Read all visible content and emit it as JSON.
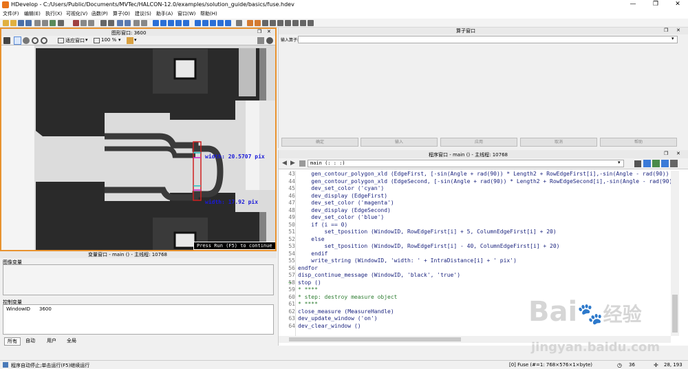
{
  "app": {
    "title": "HDevelop - C:/Users/Public/Documents/MVTec/HALCON-12.0/examples/solution_guide/basics/fuse.hdev",
    "logo": "HD",
    "minimize": "—",
    "maximize": "❐",
    "close": "✕"
  },
  "menu": [
    "文件(F)",
    "编辑(E)",
    "执行(X)",
    "可视化(V)",
    "函数(P)",
    "算子(O)",
    "建议(S)",
    "助手(A)",
    "窗口(W)",
    "帮助(H)"
  ],
  "graphics": {
    "title": "图形窗口: 3600",
    "zoom_fit": "适应窗口",
    "zoom_pct": "100 %",
    "label_top": "width: 20.5707 pix",
    "label_bottom": "width: 17.92 pix",
    "continue_msg": "Press Run (F5) to continue"
  },
  "variables": {
    "title": "变量窗口 - main () - 主线程: 10768",
    "image_vars_label": "图像变量",
    "control_vars_label": "控制变量",
    "control_vars": [
      {
        "name": "WindowID",
        "value": "3600"
      }
    ],
    "tabs": [
      "所有",
      "自动",
      "用户",
      "全局"
    ]
  },
  "operator": {
    "title": "算子窗口",
    "input_label": "输入算子或函数",
    "buttons": [
      "确定",
      "输入",
      "应用",
      "取消",
      "帮助"
    ]
  },
  "program": {
    "title": "程序窗口 - main () - 主线程: 10768",
    "proc_select": "main (: : :)",
    "pc_line": 58,
    "lines": [
      {
        "n": "43",
        "t": "    gen_contour_polygon_xld (EdgeFirst, [-sin(Angle + rad(90)) * Length2 + RowEdgeFirst[i],-sin(Angle - rad(90)) * L",
        "c": "#1a237e"
      },
      {
        "n": "44",
        "t": "    gen_contour_polygon_xld (EdgeSecond, [-sin(Angle + rad(90)) * Length2 + RowEdgeSecond[i],-sin(Angle - rad(90)) *",
        "c": "#1a237e"
      },
      {
        "n": "45",
        "t": "    dev_set_color ('cyan')",
        "c": "#1a237e"
      },
      {
        "n": "46",
        "t": "    dev_display (EdgeFirst)",
        "c": "#1a237e"
      },
      {
        "n": "47",
        "t": "    dev_set_color ('magenta')",
        "c": "#1a237e"
      },
      {
        "n": "48",
        "t": "    dev_display (EdgeSecond)",
        "c": "#1a237e"
      },
      {
        "n": "49",
        "t": "    dev_set_color ('blue')",
        "c": "#1a237e"
      },
      {
        "n": "50",
        "t": "    if (i == 0)",
        "c": "#1a237e"
      },
      {
        "n": "51",
        "t": "        set_tposition (WindowID, RowEdgeFirst[i] + 5, ColumnEdgeFirst[i] + 20)",
        "c": "#1a237e"
      },
      {
        "n": "52",
        "t": "    else",
        "c": "#1a237e"
      },
      {
        "n": "53",
        "t": "        set_tposition (WindowID, RowEdgeFirst[i] - 40, ColumnEdgeFirst[i] + 20)",
        "c": "#1a237e"
      },
      {
        "n": "54",
        "t": "    endif",
        "c": "#1a237e"
      },
      {
        "n": "55",
        "t": "    write_string (WindowID, 'width: ' + IntraDistance[i] + ' pix')",
        "c": "#1a237e"
      },
      {
        "n": "56",
        "t": "endfor",
        "c": "#1a237e"
      },
      {
        "n": "57",
        "t": "disp_continue_message (WindowID, 'black', 'true')",
        "c": "#1a237e"
      },
      {
        "n": "58",
        "t": "stop ()",
        "c": "#1a237e"
      },
      {
        "n": "59",
        "t": "* ****",
        "c": "#2e7d32"
      },
      {
        "n": "60",
        "t": "* step: destroy measure object",
        "c": "#2e7d32"
      },
      {
        "n": "61",
        "t": "* ****",
        "c": "#2e7d32"
      },
      {
        "n": "62",
        "t": "close_measure (MeasureHandle)",
        "c": "#1a237e"
      },
      {
        "n": "63",
        "t": "dev_update_window ('on')",
        "c": "#1a237e"
      },
      {
        "n": "64",
        "t": "dev_clear_window ()",
        "c": "#1a237e"
      }
    ]
  },
  "status": {
    "message": "程序自动停止;单击运行(F5)继续运行",
    "image_info": "[0] Fuse (#=1: 768×576×1×byte)",
    "count": "36",
    "coords": "28, 193"
  },
  "watermark": {
    "brand": "Bai",
    "brand2": "经验",
    "url": "jingyan.baidu.com"
  },
  "colors": {
    "accent": "#e8922e",
    "code": "#1a237e",
    "comment": "#2e7d32",
    "label": "#1a1ad8"
  }
}
